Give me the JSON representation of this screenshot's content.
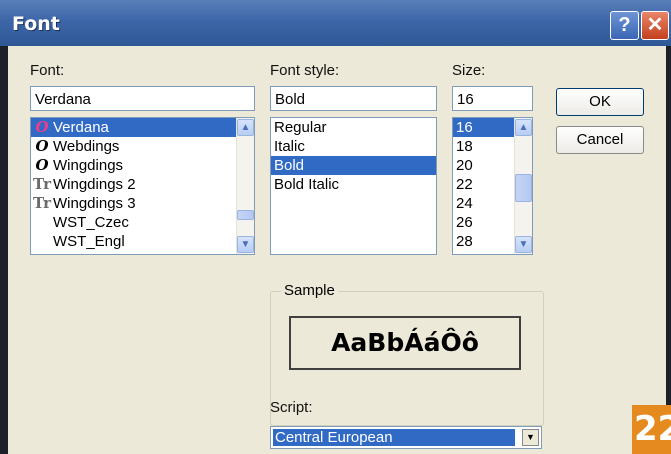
{
  "window": {
    "title": "Font",
    "help_glyph": "?",
    "close_glyph": "✕"
  },
  "font": {
    "label": "Font:",
    "value": "Verdana",
    "items": [
      {
        "icon": "O",
        "icon_type": "opentype",
        "name": "Verdana",
        "selected": true
      },
      {
        "icon": "O",
        "icon_type": "opentype",
        "name": "Webdings"
      },
      {
        "icon": "O",
        "icon_type": "opentype",
        "name": "Wingdings"
      },
      {
        "icon": "Tr",
        "icon_type": "truetype",
        "name": "Wingdings 2"
      },
      {
        "icon": "Tr",
        "icon_type": "truetype",
        "name": "Wingdings 3"
      },
      {
        "icon": "",
        "icon_type": "none",
        "name": "WST_Czec"
      },
      {
        "icon": "",
        "icon_type": "none",
        "name": "WST_Engl"
      }
    ]
  },
  "style": {
    "label": "Font style:",
    "value": "Bold",
    "items": [
      {
        "name": "Regular"
      },
      {
        "name": "Italic"
      },
      {
        "name": "Bold",
        "selected": true
      },
      {
        "name": "Bold Italic"
      }
    ]
  },
  "size": {
    "label": "Size:",
    "value": "16",
    "items": [
      {
        "name": "16",
        "selected": true
      },
      {
        "name": "18"
      },
      {
        "name": "20"
      },
      {
        "name": "22"
      },
      {
        "name": "24"
      },
      {
        "name": "26"
      },
      {
        "name": "28"
      }
    ]
  },
  "buttons": {
    "ok": "OK",
    "cancel": "Cancel"
  },
  "sample": {
    "label": "Sample",
    "text": "AaBbÁáÔô"
  },
  "script": {
    "label": "Script:",
    "value": "Central European"
  },
  "badge": "22",
  "colors": {
    "titlebar": "#3d66a8",
    "selection": "#316ac5",
    "badge": "#e58a1f"
  }
}
